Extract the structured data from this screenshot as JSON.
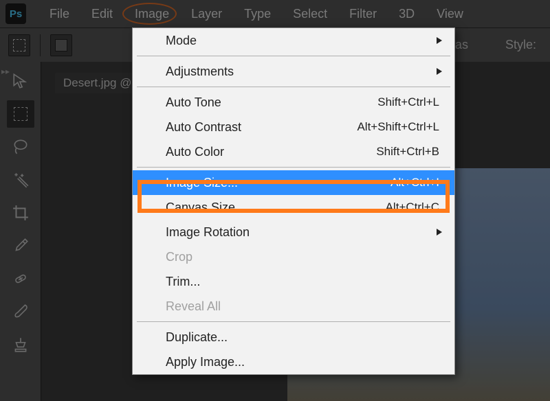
{
  "app": {
    "logo": "Ps"
  },
  "menubar": [
    "File",
    "Edit",
    "Image",
    "Layer",
    "Type",
    "Select",
    "Filter",
    "3D",
    "View"
  ],
  "optionsbar": {
    "style_label": "Style:",
    "as_label": "as"
  },
  "document": {
    "tab": "Desert.jpg @"
  },
  "dropdown": {
    "mode": "Mode",
    "adjustments": "Adjustments",
    "auto_tone": {
      "label": "Auto Tone",
      "shortcut": "Shift+Ctrl+L"
    },
    "auto_contrast": {
      "label": "Auto Contrast",
      "shortcut": "Alt+Shift+Ctrl+L"
    },
    "auto_color": {
      "label": "Auto Color",
      "shortcut": "Shift+Ctrl+B"
    },
    "image_size": {
      "label": "Image Size...",
      "shortcut": "Alt+Ctrl+I"
    },
    "canvas_size": {
      "label": "Canvas Size...",
      "shortcut": "Alt+Ctrl+C"
    },
    "image_rotation": "Image Rotation",
    "crop": "Crop",
    "trim": "Trim...",
    "reveal_all": "Reveal All",
    "duplicate": "Duplicate...",
    "apply_image": "Apply Image..."
  }
}
